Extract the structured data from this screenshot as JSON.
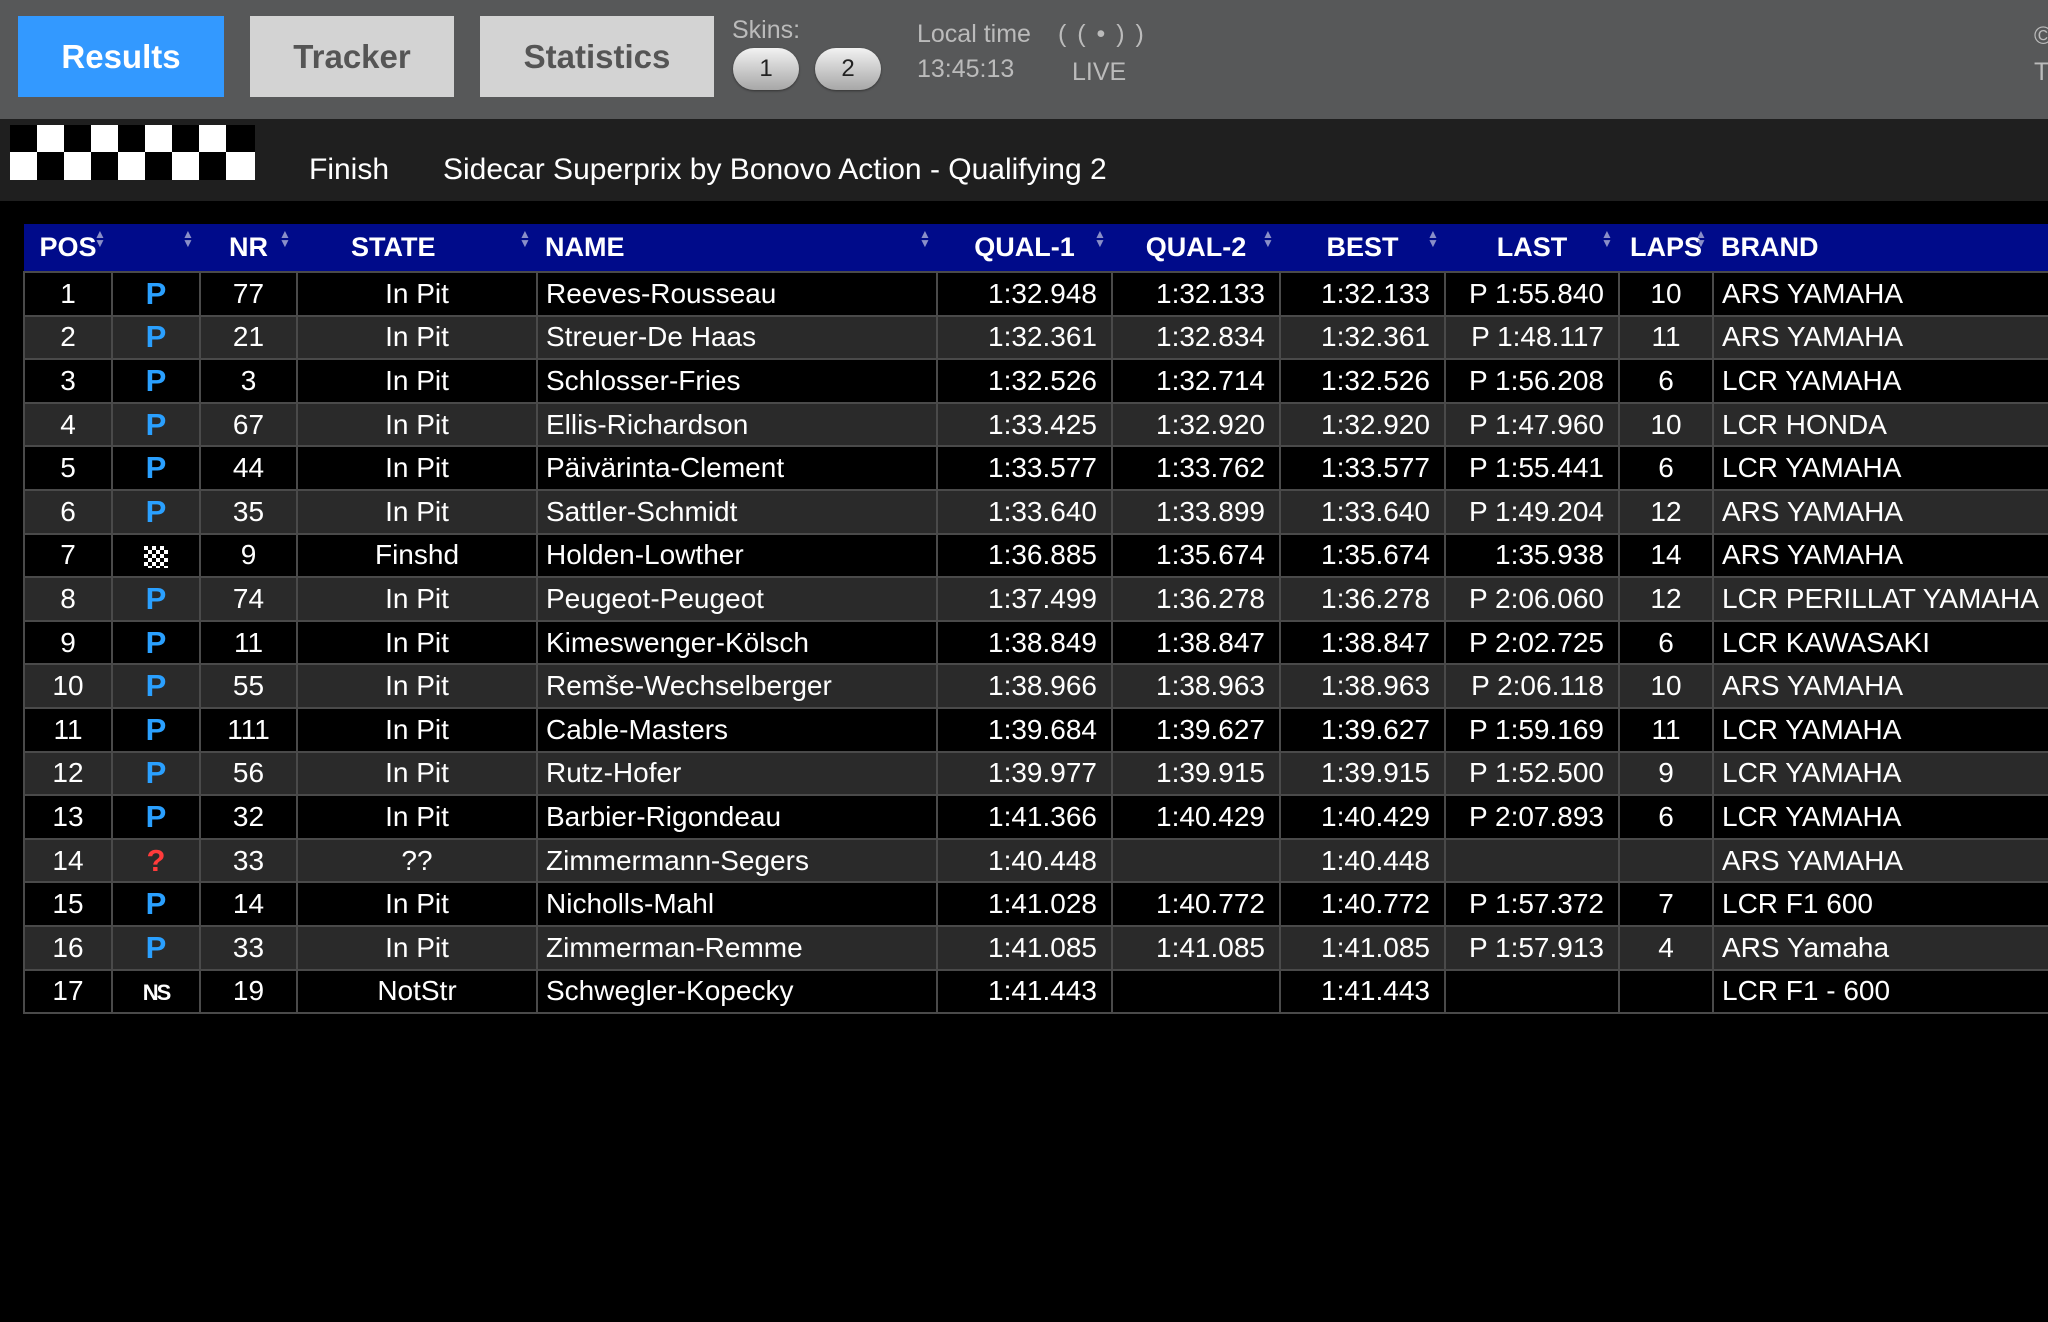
{
  "nav": {
    "tabs": [
      "Results",
      "Tracker",
      "Statistics"
    ],
    "active_tab": "Results",
    "skins_label": "Skins:",
    "skins": [
      "1",
      "2"
    ],
    "local_time_label": "Local time",
    "local_time": "13:45:13",
    "live_icon": "( ( • ) )",
    "live_label": "LIVE",
    "edge_text_1": "©",
    "edge_text_2": "T"
  },
  "session": {
    "flag_icon": "checkered-flag-icon",
    "state": "Finish",
    "title": "Sidecar Superprix by Bonovo Action - Qualifying 2"
  },
  "table": {
    "columns": [
      "POS",
      "",
      "NR",
      "STATE",
      "NAME",
      "QUAL-1",
      "QUAL-2",
      "BEST",
      "LAST",
      "LAPS",
      "BRAND"
    ],
    "icon_legend": {
      "pit": "P",
      "unknown": "?",
      "not_started": "NS",
      "finished": "checkered-flag-icon"
    },
    "rows": [
      {
        "pos": "1",
        "icon": "pit",
        "nr": "77",
        "state": "In Pit",
        "name": "Reeves-Rousseau",
        "qual1": "1:32.948",
        "qual2": "1:32.133",
        "best": "1:32.133",
        "last": "P 1:55.840",
        "laps": "10",
        "brand": "ARS YAMAHA"
      },
      {
        "pos": "2",
        "icon": "pit",
        "nr": "21",
        "state": "In Pit",
        "name": "Streuer-De Haas",
        "qual1": "1:32.361",
        "qual2": "1:32.834",
        "best": "1:32.361",
        "last": "P 1:48.117",
        "laps": "11",
        "brand": "ARS YAMAHA"
      },
      {
        "pos": "3",
        "icon": "pit",
        "nr": "3",
        "state": "In Pit",
        "name": "Schlosser-Fries",
        "qual1": "1:32.526",
        "qual2": "1:32.714",
        "best": "1:32.526",
        "last": "P 1:56.208",
        "laps": "6",
        "brand": "LCR YAMAHA"
      },
      {
        "pos": "4",
        "icon": "pit",
        "nr": "67",
        "state": "In Pit",
        "name": "Ellis-Richardson",
        "qual1": "1:33.425",
        "qual2": "1:32.920",
        "best": "1:32.920",
        "last": "P 1:47.960",
        "laps": "10",
        "brand": "LCR HONDA"
      },
      {
        "pos": "5",
        "icon": "pit",
        "nr": "44",
        "state": "In Pit",
        "name": "Päivärinta-Clement",
        "qual1": "1:33.577",
        "qual2": "1:33.762",
        "best": "1:33.577",
        "last": "P 1:55.441",
        "laps": "6",
        "brand": "LCR YAMAHA"
      },
      {
        "pos": "6",
        "icon": "pit",
        "nr": "35",
        "state": "In Pit",
        "name": "Sattler-Schmidt",
        "qual1": "1:33.640",
        "qual2": "1:33.899",
        "best": "1:33.640",
        "last": "P 1:49.204",
        "laps": "12",
        "brand": "ARS YAMAHA"
      },
      {
        "pos": "7",
        "icon": "finished",
        "nr": "9",
        "state": "Finshd",
        "name": "Holden-Lowther",
        "qual1": "1:36.885",
        "qual2": "1:35.674",
        "best": "1:35.674",
        "last": "1:35.938",
        "laps": "14",
        "brand": "ARS YAMAHA"
      },
      {
        "pos": "8",
        "icon": "pit",
        "nr": "74",
        "state": "In Pit",
        "name": "Peugeot-Peugeot",
        "qual1": "1:37.499",
        "qual2": "1:36.278",
        "best": "1:36.278",
        "last": "P 2:06.060",
        "laps": "12",
        "brand": "LCR PERILLAT YAMAHA"
      },
      {
        "pos": "9",
        "icon": "pit",
        "nr": "11",
        "state": "In Pit",
        "name": "Kimeswenger-Kölsch",
        "qual1": "1:38.849",
        "qual2": "1:38.847",
        "best": "1:38.847",
        "last": "P 2:02.725",
        "laps": "6",
        "brand": "LCR KAWASAKI"
      },
      {
        "pos": "10",
        "icon": "pit",
        "nr": "55",
        "state": "In Pit",
        "name": "Remše-Wechselberger",
        "qual1": "1:38.966",
        "qual2": "1:38.963",
        "best": "1:38.963",
        "last": "P 2:06.118",
        "laps": "10",
        "brand": "ARS YAMAHA"
      },
      {
        "pos": "11",
        "icon": "pit",
        "nr": "111",
        "state": "In Pit",
        "name": "Cable-Masters",
        "qual1": "1:39.684",
        "qual2": "1:39.627",
        "best": "1:39.627",
        "last": "P 1:59.169",
        "laps": "11",
        "brand": "LCR YAMAHA"
      },
      {
        "pos": "12",
        "icon": "pit",
        "nr": "56",
        "state": "In Pit",
        "name": "Rutz-Hofer",
        "qual1": "1:39.977",
        "qual2": "1:39.915",
        "best": "1:39.915",
        "last": "P 1:52.500",
        "laps": "9",
        "brand": "LCR YAMAHA"
      },
      {
        "pos": "13",
        "icon": "pit",
        "nr": "32",
        "state": "In Pit",
        "name": "Barbier-Rigondeau",
        "qual1": "1:41.366",
        "qual2": "1:40.429",
        "best": "1:40.429",
        "last": "P 2:07.893",
        "laps": "6",
        "brand": "LCR YAMAHA"
      },
      {
        "pos": "14",
        "icon": "unknown",
        "nr": "33",
        "state": "??",
        "name": "Zimmermann-Segers",
        "qual1": "1:40.448",
        "qual2": "",
        "best": "1:40.448",
        "last": "",
        "laps": "",
        "brand": "ARS YAMAHA"
      },
      {
        "pos": "15",
        "icon": "pit",
        "nr": "14",
        "state": "In Pit",
        "name": "Nicholls-Mahl",
        "qual1": "1:41.028",
        "qual2": "1:40.772",
        "best": "1:40.772",
        "last": "P 1:57.372",
        "laps": "7",
        "brand": "LCR F1 600"
      },
      {
        "pos": "16",
        "icon": "pit",
        "nr": "33",
        "state": "In Pit",
        "name": "Zimmerman-Remme",
        "qual1": "1:41.085",
        "qual2": "1:41.085",
        "best": "1:41.085",
        "last": "P 1:57.913",
        "laps": "4",
        "brand": "ARS Yamaha"
      },
      {
        "pos": "17",
        "icon": "not_started",
        "nr": "19",
        "state": "NotStr",
        "name": "Schwegler-Kopecky",
        "qual1": "1:41.443",
        "qual2": "",
        "best": "1:41.443",
        "last": "",
        "laps": "",
        "brand": "LCR F1 - 600"
      }
    ]
  }
}
